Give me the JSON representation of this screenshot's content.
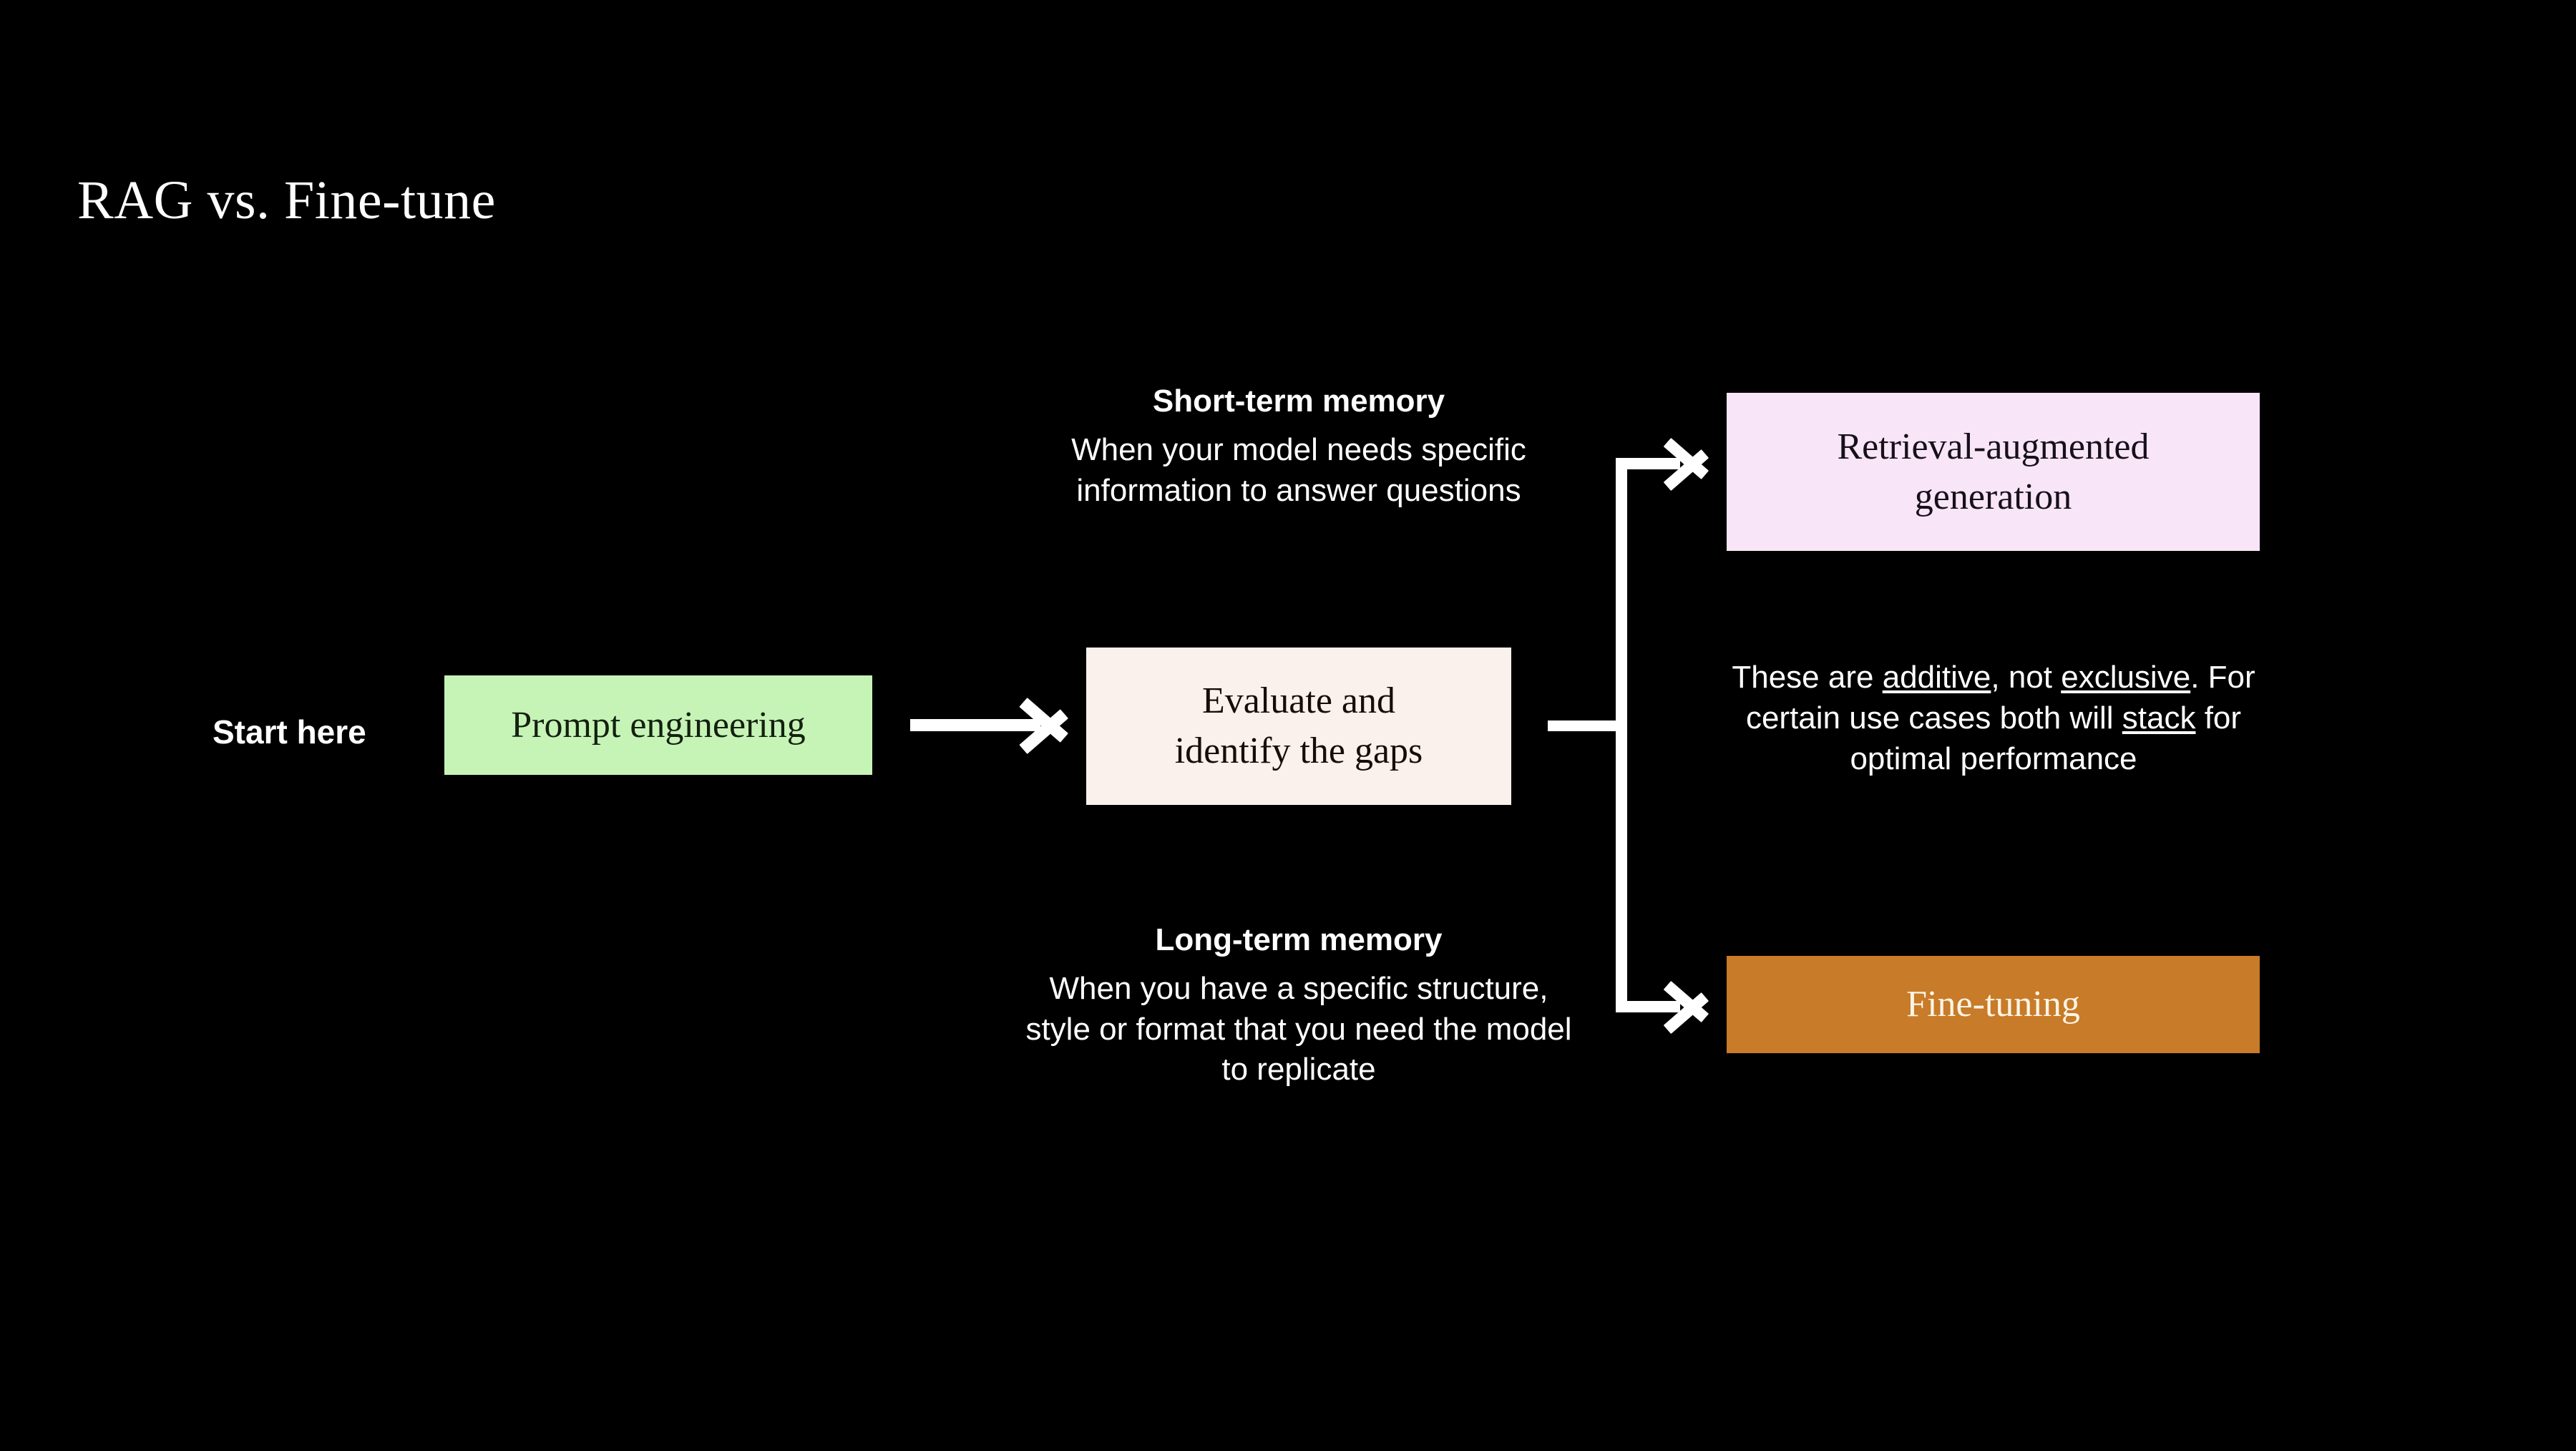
{
  "slide": {
    "title": "RAG vs. Fine-tune",
    "background_color": "#000000"
  },
  "start_label": "Start here",
  "nodes": {
    "prompt_engineering": {
      "label": "Prompt engineering",
      "fill": "#c6f4b7",
      "text_color": "#14200f"
    },
    "evaluate": {
      "line1": "Evaluate and",
      "line2": "identify the gaps",
      "fill": "#faf0ec",
      "text_color": "#140d0a"
    },
    "rag": {
      "line1": "Retrieval-augmented",
      "line2": "generation",
      "fill": "#f8e5f7",
      "text_color": "#16101a"
    },
    "fine_tuning": {
      "label": "Fine-tuning",
      "fill": "#c87b28",
      "text_color": "#fdf4e6"
    }
  },
  "annotations": {
    "short_term": {
      "heading": "Short-term memory",
      "body": "When your model needs specific information to answer questions"
    },
    "long_term": {
      "heading": "Long-term memory",
      "body": "When you have a specific structure, style or format that you need the model to replicate"
    },
    "stack_note": {
      "part1": "These are ",
      "underline1": "additive",
      "part2": ", not ",
      "underline2": "exclusive",
      "part3": ". For certain use cases both will ",
      "underline3": "stack",
      "part4": " for optimal performance"
    }
  },
  "connectors": {
    "main_arrow": "arrow-right-icon",
    "branch_top_arrow": "arrow-right-icon",
    "branch_bottom_arrow": "arrow-right-icon",
    "accent_color": "#ffffff"
  }
}
